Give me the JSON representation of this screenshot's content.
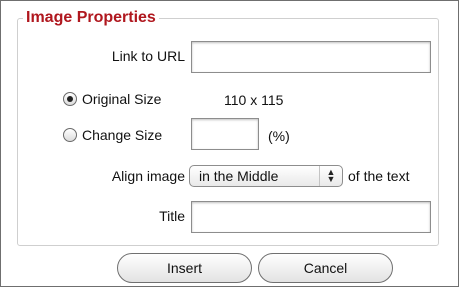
{
  "dialog": {
    "legend": "Image Properties",
    "link_url": {
      "label": "Link to URL",
      "value": "",
      "placeholder": ""
    },
    "original_size": {
      "label": "Original Size",
      "selected": true,
      "dimensions": "110 x 115"
    },
    "change_size": {
      "label": "Change Size",
      "selected": false,
      "value": "",
      "unit": "(%)"
    },
    "align": {
      "label": "Align image",
      "selected": "in the Middle",
      "suffix": "of the text"
    },
    "title_field": {
      "label": "Title",
      "value": ""
    },
    "buttons": {
      "insert": "Insert",
      "cancel": "Cancel"
    }
  },
  "colors": {
    "legend": "#b0171e",
    "border": "#cfcfcf"
  }
}
